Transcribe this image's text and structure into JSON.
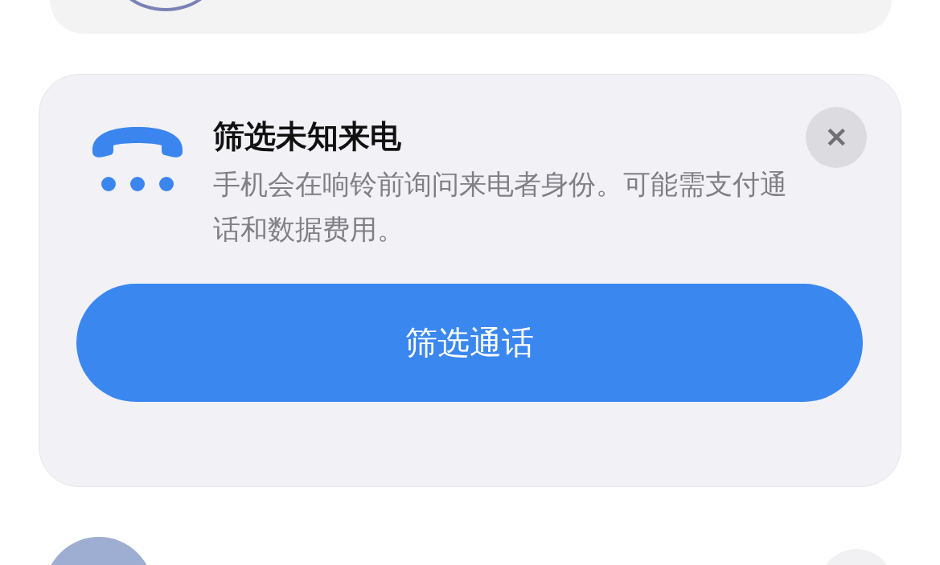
{
  "card": {
    "title": "筛选未知来电",
    "description": "手机会在响铃前询问来电者身份。可能需支付通话和数据费用。",
    "close_button": "✕",
    "action_button": "筛选通话"
  }
}
